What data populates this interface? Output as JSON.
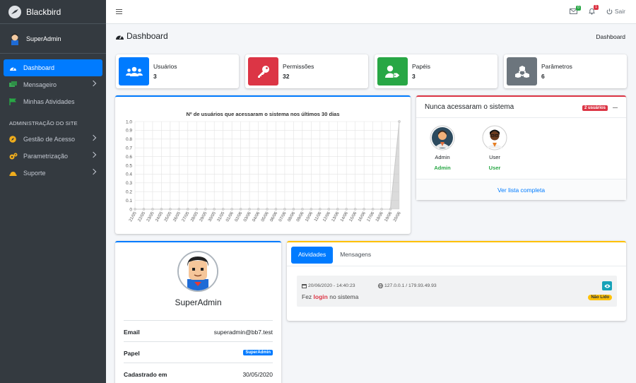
{
  "brand": {
    "name": "Blackbird"
  },
  "user_panel": {
    "name": "SuperAdmin"
  },
  "sidebar": {
    "items": [
      {
        "label": "Dashboard"
      },
      {
        "label": "Mensageiro"
      },
      {
        "label": "Minhas Atividades"
      }
    ],
    "header": "ADMINISTRAÇÃO DO SITE",
    "admin_items": [
      {
        "label": "Gestão de Acesso"
      },
      {
        "label": "Parametrização"
      },
      {
        "label": "Suporte"
      }
    ]
  },
  "topbar": {
    "msg_count": "0",
    "notif_count": "1",
    "logout": "Sair"
  },
  "content_header": {
    "title": "Dashboard",
    "breadcrumb": "Dashboard"
  },
  "info_boxes": [
    {
      "label": "Usuários",
      "value": "3",
      "color": "#007bff"
    },
    {
      "label": "Permissões",
      "value": "32",
      "color": "#dc3545"
    },
    {
      "label": "Papéis",
      "value": "3",
      "color": "#28a745"
    },
    {
      "label": "Parâmetros",
      "value": "6",
      "color": "#6c757d"
    }
  ],
  "chart_data": {
    "type": "area",
    "title": "Nº de usuários que acessaram o sistema nos últimos 30 dias",
    "categories": [
      "21/05",
      "22/05",
      "23/05",
      "24/05",
      "25/05",
      "26/05",
      "27/05",
      "28/05",
      "29/05",
      "30/05",
      "31/05",
      "01/06",
      "02/06",
      "03/06",
      "04/06",
      "05/06",
      "06/06",
      "07/06",
      "08/06",
      "09/06",
      "10/06",
      "11/06",
      "12/06",
      "13/06",
      "14/06",
      "15/06",
      "16/06",
      "17/06",
      "18/06",
      "19/06",
      "20/06"
    ],
    "values": [
      0,
      0,
      0,
      0,
      0,
      0,
      0,
      0,
      0,
      0,
      0,
      0,
      0,
      0,
      0,
      0,
      0,
      0,
      0,
      0,
      0,
      0,
      0,
      0,
      0,
      0,
      0,
      0,
      0,
      0,
      1
    ],
    "ylim": [
      0,
      1
    ],
    "yticks": [
      "0",
      "0.1",
      "0.2",
      "0.3",
      "0.4",
      "0.5",
      "0.6",
      "0.7",
      "0.8",
      "0.9",
      "1.0"
    ],
    "grid": true
  },
  "never_accessed": {
    "title": "Nunca acessaram o sistema",
    "badge": "2 usuários",
    "users": [
      {
        "name": "Admin",
        "role": "Admin"
      },
      {
        "name": "User",
        "role": "User"
      }
    ],
    "footer_link": "Ver lista completa"
  },
  "profile": {
    "name": "SuperAdmin",
    "email_label": "Email",
    "email": "superadmin@bb7.test",
    "role_label": "Papel",
    "role": "SuperAdmin",
    "registered_label": "Cadastrado em",
    "registered": "30/05/2020"
  },
  "activity": {
    "tabs": [
      {
        "label": "Atividades"
      },
      {
        "label": "Mensagens"
      }
    ],
    "items": [
      {
        "date": "20/06/2020 - 14:40:23",
        "ip": "127.0.0.1 / 179.93.49.93",
        "text_before": "Fez",
        "text_highlight": "login",
        "text_after": "no sistema",
        "status": "Não Lido"
      }
    ]
  }
}
